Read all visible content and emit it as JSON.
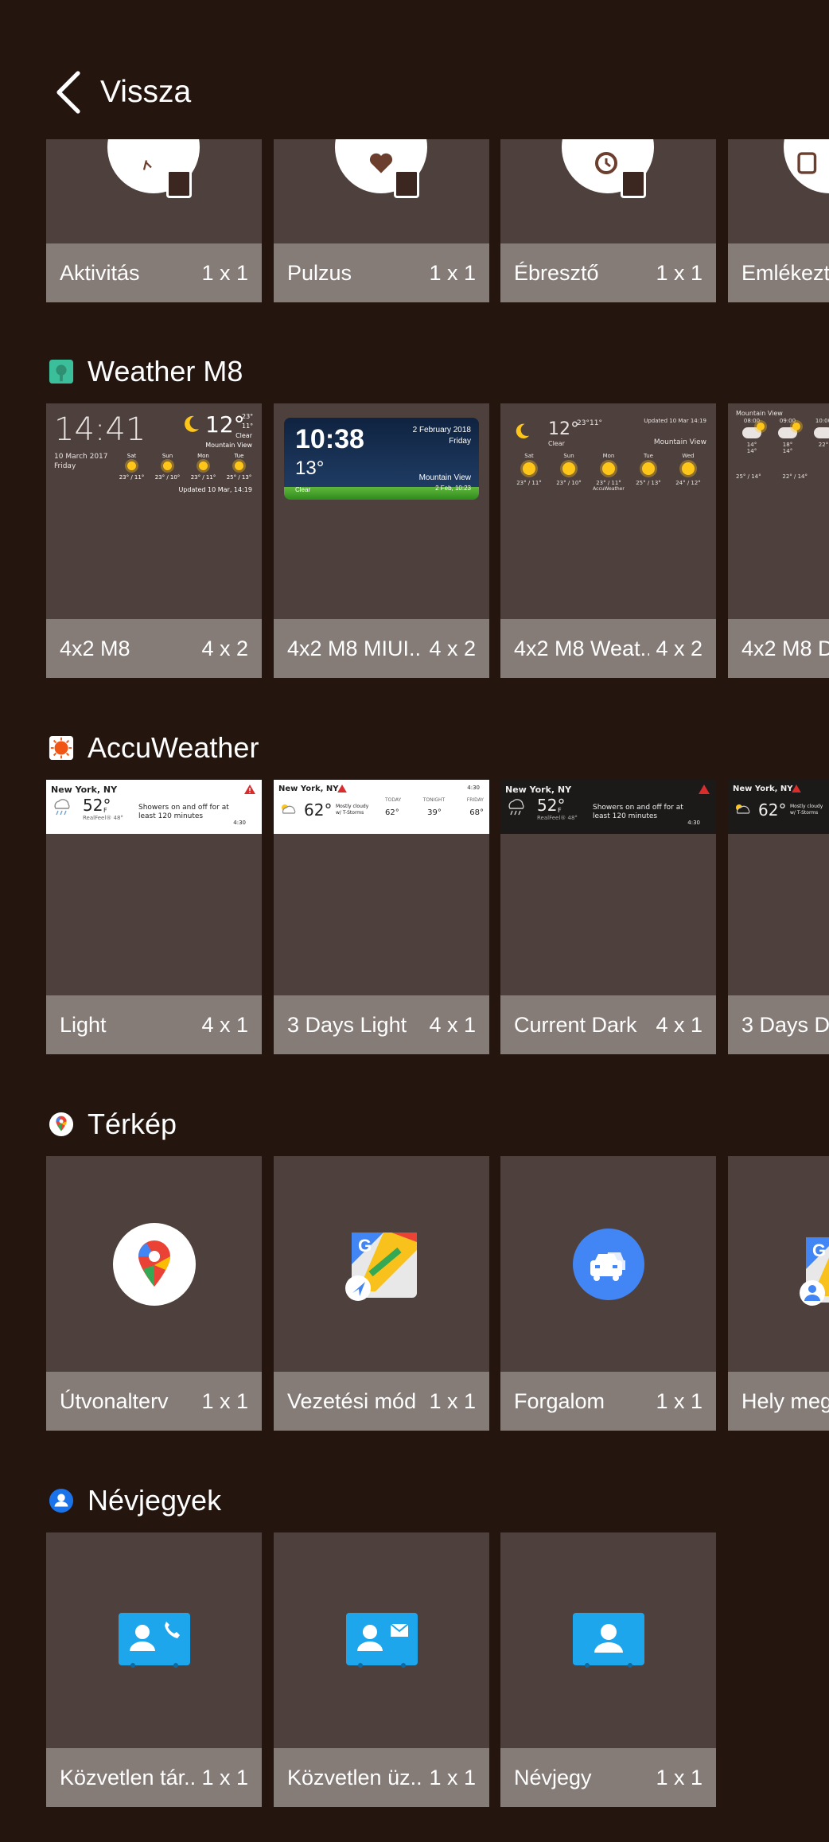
{
  "header": {
    "back_label": "Vissza"
  },
  "sections": {
    "health": {
      "tiles": [
        {
          "name": "Aktivitás",
          "size": "1 x 1"
        },
        {
          "name": "Pulzus",
          "size": "1 x 1"
        },
        {
          "name": "Ébresztő",
          "size": "1 x 1"
        },
        {
          "name": "Emlékezt",
          "size": ""
        }
      ]
    },
    "weather_m8": {
      "title": "Weather M8",
      "tiles": [
        {
          "name": "4x2 M8",
          "size": "4 x 2"
        },
        {
          "name": "4x2 M8 MIUI...",
          "size": "4 x 2"
        },
        {
          "name": "4x2 M8 Weat...",
          "size": "4 x 2"
        },
        {
          "name": "4x2 M8 D",
          "size": ""
        }
      ],
      "previews": {
        "p1": {
          "time": "14:41",
          "temp": "12°",
          "hi": "23°",
          "lo": "11°",
          "cond": "Clear",
          "place": "Mountain View",
          "date": "10 March 2017",
          "day": "Friday",
          "updated": "Updated 10 Mar, 14:19",
          "days": [
            "Sat",
            "Sun",
            "Mon",
            "Tue"
          ],
          "temps": [
            "23° / 11°",
            "23° / 10°",
            "23° / 11°",
            "25° / 13°"
          ]
        },
        "p2": {
          "time": "10:38",
          "date": "2 February 2018",
          "day": "Friday",
          "temp": "13°",
          "cond": "Clear",
          "place": "Mountain View",
          "updated": "2 Feb, 10:23"
        },
        "p3": {
          "temp": "12°",
          "hi": "23°",
          "lo": "11°",
          "cond": "Clear",
          "place": "Mountain View",
          "updated": "Updated 10 Mar 14:19",
          "days": [
            "Sat",
            "Sun",
            "Mon",
            "Tue",
            "Wed"
          ],
          "temps": [
            "23° / 11°",
            "23° / 10°",
            "23° / 11°",
            "25° / 13°",
            "24° / 12°"
          ],
          "source": "AccuWeather"
        },
        "p4": {
          "place": "Mountain View",
          "times": [
            "08:00",
            "09:00",
            "10:00"
          ],
          "temps": [
            "14°",
            "18°",
            "22°"
          ],
          "lows": [
            "14°",
            "14°"
          ],
          "range": [
            "25° / 14°",
            "22° / 14°"
          ]
        }
      }
    },
    "accuweather": {
      "title": "AccuWeather",
      "tiles": [
        {
          "name": "Light",
          "size": "4 x 1"
        },
        {
          "name": "3 Days Light",
          "size": "4 x 1"
        },
        {
          "name": "Current Dark",
          "size": "4 x 1"
        },
        {
          "name": "3 Days Da",
          "size": ""
        }
      ],
      "previews": {
        "city": "New York, NY",
        "temp": "52°",
        "unit": "F",
        "realfeel": "RealFeel® 48°",
        "forecast": "Showers on and off for at least 120 minutes",
        "time": "4:30",
        "temp3": "62°",
        "cond3": "Mostly cloudy w/ T-Storms",
        "today_l": "TODAY",
        "tonight_l": "TONIGHT",
        "friday_l": "FRIDAY",
        "today": "62°",
        "tonight": "39°",
        "friday": "68°"
      }
    },
    "maps": {
      "title": "Térkép",
      "tiles": [
        {
          "name": "Útvonalterv",
          "size": "1 x 1"
        },
        {
          "name": "Vezetési mód",
          "size": "1 x 1"
        },
        {
          "name": "Forgalom",
          "size": "1 x 1"
        },
        {
          "name": "Hely meg",
          "size": ""
        }
      ]
    },
    "contacts": {
      "title": "Névjegyek",
      "tiles": [
        {
          "name": "Közvetlen tár...",
          "size": "1 x 1"
        },
        {
          "name": "Közvetlen üz...",
          "size": "1 x 1"
        },
        {
          "name": "Névjegy",
          "size": "1 x 1"
        }
      ]
    }
  },
  "colors": {
    "background": "#24150f",
    "tile": "#4e403c",
    "label_bar": "#857b77",
    "maps_blue": "#4285f4",
    "contacts_blue": "#1ea6ec"
  }
}
